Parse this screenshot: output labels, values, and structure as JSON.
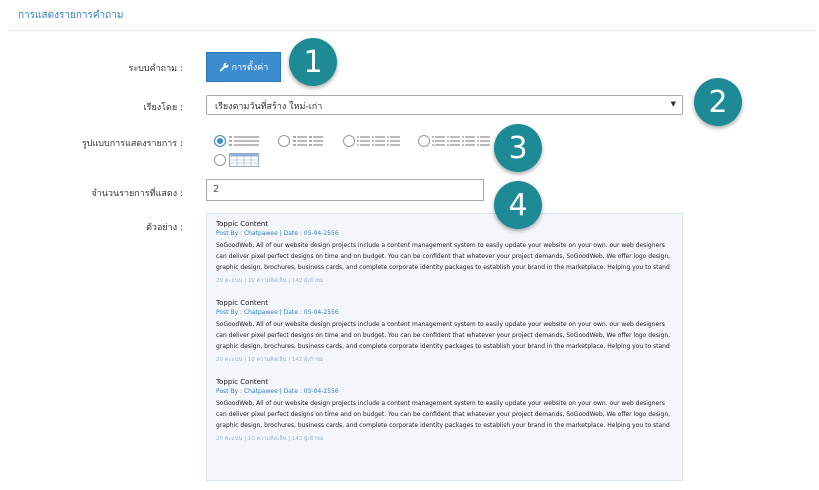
{
  "page_title": "การแสดงรายการคำถาม",
  "labels": {
    "question_system": "ระบบคำถาม :",
    "sort_by": "เรียงโดย :",
    "display_format": "รูปแบบการแสดงรายการ :",
    "item_count": "จำนวนรายการที่แสดง :",
    "example": "ตัวอย่าง :"
  },
  "settings_button": {
    "label": "การตั้งค่า",
    "icon": "wrench-icon"
  },
  "sort_select": {
    "value": "เรียงตามวันที่สร้าง ใหม่-เก่า"
  },
  "display_options": [
    {
      "name": "list-1-column",
      "checked": true
    },
    {
      "name": "list-2-columns",
      "checked": false
    },
    {
      "name": "list-3-columns",
      "checked": false
    },
    {
      "name": "list-4-columns",
      "checked": false
    },
    {
      "name": "grid-table",
      "checked": false
    }
  ],
  "count_input": {
    "value": "2"
  },
  "preview_items": [
    {
      "title": "Toppic Content",
      "meta": "Post By : Chatpawee  |  Date : 05-04-2556",
      "body": "SoGoodWeb, All of our website design projects include a content management system to easily update your website on your own. our web designers can deliver pixel perfect designs on time and on budget. You can be confident that whatever your project demands, SoGoodWeb, We offer logo design, graphic design, brochures, business cards, and complete corporate identity packages to establish your brand in the marketplace. Helping you to stand out among",
      "stats": "20 คะแนน | 10 ความคิดเห็น | 142 ผู้เข้าชม"
    },
    {
      "title": "Toppic Content",
      "meta": "Post By : Chatpawee  |  Date : 05-04-2556",
      "body": "SoGoodWeb, All of our website design projects include a content management system to easily update your website on your own. our web designers can deliver pixel perfect designs on time and on budget. You can be confident that whatever your project demands, SoGoodWeb, We offer logo design, graphic design, brochures, business cards, and complete corporate identity packages to establish your brand in the marketplace. Helping you to stand out among",
      "stats": "20 คะแนน | 10 ความคิดเห็น | 142 ผู้เข้าชม"
    },
    {
      "title": "Toppic Content",
      "meta": "Post By : Chatpawee  |  Date : 05-04-2556",
      "body": "SoGoodWeb, All of our website design projects include a content management system to easily update your website on your own. our web designers can deliver pixel perfect designs on time and on budget. You can be confident that whatever your project demands, SoGoodWeb, We offer logo design, graphic design, brochures, business cards, and complete corporate identity packages to establish your brand in the marketplace. Helping you to stand out among",
      "stats": "20 คะแนน | 10 ความคิดเห็น | 142 ผู้เข้าชม"
    }
  ],
  "annotations": [
    "1",
    "2",
    "3",
    "4"
  ],
  "colors": {
    "accent": "#3c8dd0",
    "badge": "#1e8a95",
    "preview_bg": "#f3f7fb"
  }
}
